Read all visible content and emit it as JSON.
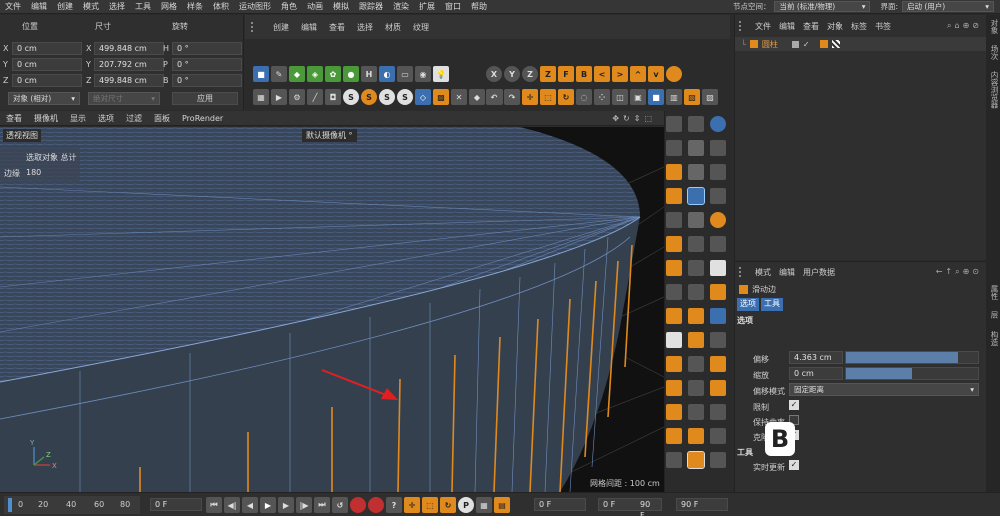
{
  "menu": {
    "items": [
      "文件",
      "编辑",
      "创建",
      "模式",
      "选择",
      "工具",
      "网格",
      "样条",
      "体积",
      "运动图形",
      "角色",
      "动画",
      "模拟",
      "跟踪器",
      "渲染",
      "扩展",
      "窗口",
      "帮助"
    ],
    "node_space_label": "节点空间：",
    "node_space_value": "当前 (标准/物理)",
    "interface_label": "界面:",
    "interface_value": "启动 (用户)"
  },
  "coords": {
    "col_position": "位置",
    "col_size": "尺寸",
    "col_rotation": "旋转",
    "rows": [
      {
        "axis": "X",
        "pos": "0 cm",
        "size": "499.848 cm",
        "rot_axis": "H",
        "rot": "0 °"
      },
      {
        "axis": "Y",
        "pos": "0 cm",
        "size": "207.792 cm",
        "rot_axis": "P",
        "rot": "0 °"
      },
      {
        "axis": "Z",
        "pos": "0 cm",
        "size": "499.848 cm",
        "rot_axis": "B",
        "rot": "0 °"
      }
    ],
    "mode_select": "对象 (相对)",
    "size_select": "绝对尺寸",
    "apply": "应用"
  },
  "material_menu": [
    "创建",
    "编辑",
    "查看",
    "选择",
    "材质",
    "纹理"
  ],
  "toolbar_top_letters": [
    "X",
    "Y",
    "Z",
    "Z",
    "F",
    "B",
    "<",
    ">",
    "^",
    "v"
  ],
  "viewport": {
    "menu": [
      "查看",
      "摄像机",
      "显示",
      "选项",
      "过滤",
      "面板",
      "ProRender"
    ],
    "view_name": "透视视图",
    "camera": "默认摄像机 °",
    "hud_label": "选取对象 总计",
    "hud_edge_label": "边缘",
    "hud_edge_value": "180",
    "grid_spacing": "网格间距 : 100 cm"
  },
  "object_manager": {
    "menu": [
      "文件",
      "编辑",
      "查看",
      "对象",
      "标签",
      "书签"
    ],
    "object_name": "圆柱"
  },
  "attributes": {
    "menu": [
      "模式",
      "编辑",
      "用户数据"
    ],
    "tool_name": "滑动边",
    "tabs": [
      "选项",
      "工具"
    ],
    "section_options": "选项",
    "offset_label": "偏移",
    "offset_value": "4.363 cm",
    "offset_level": 0.85,
    "scale_label": "缩放",
    "scale_value": "0 cm",
    "scale_level": 0.5,
    "offset_mode_label": "偏移模式",
    "offset_mode_value": "固定距离",
    "limit_label": "限制",
    "keep_curvature_label": "保持曲率",
    "clone_label": "克隆",
    "section_tools": "工具",
    "realtime_label": "实时更新"
  },
  "side_tabs": [
    "对象",
    "场次",
    "内容浏览器",
    "属性",
    "层",
    "构造"
  ],
  "timeline": {
    "ruler": [
      "0",
      "20",
      "40",
      "60",
      "80"
    ],
    "current_frame": "0 F",
    "start": "0 F",
    "end": "90 F",
    "end2": "90 F"
  },
  "colors": {
    "accent": "#e08a1e",
    "wire": "#6a8fc7",
    "mesh": "#3d4a5c",
    "blue_btn": "#3c6fb0"
  }
}
